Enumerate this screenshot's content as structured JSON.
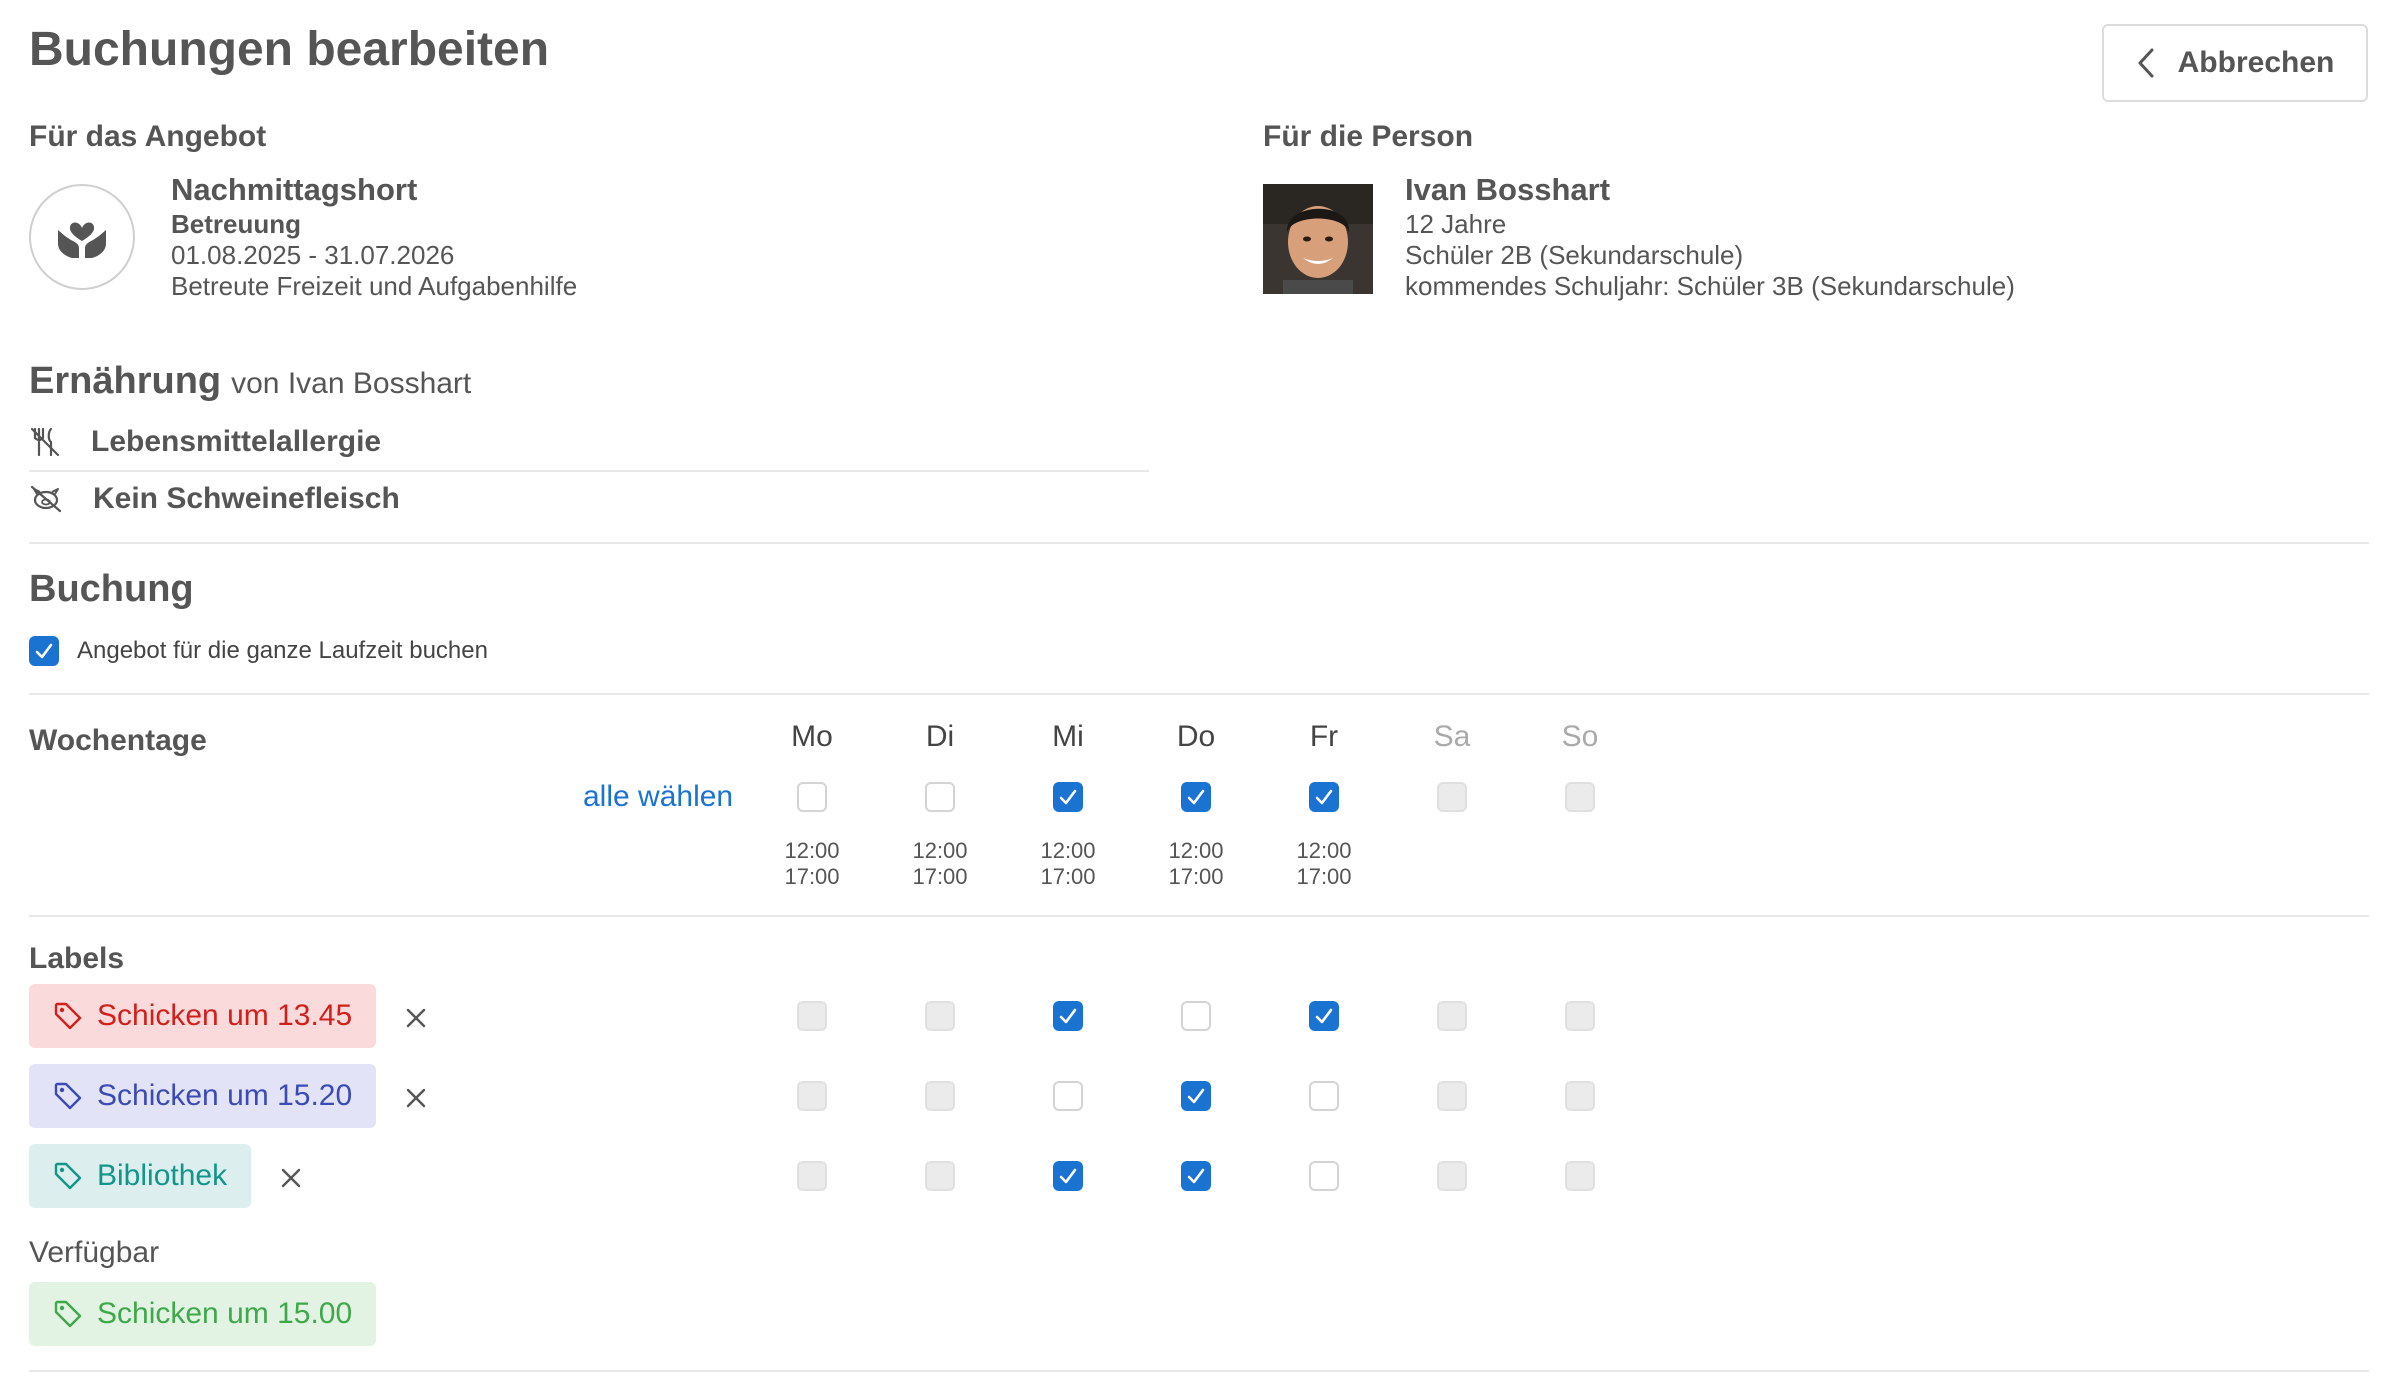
{
  "header": {
    "title": "Buchungen bearbeiten",
    "cancel_label": "Abbrechen"
  },
  "offer": {
    "section_label": "Für das Angebot",
    "name": "Nachmittagshort",
    "category": "Betreuung",
    "period": "01.08.2025 - 31.07.2026",
    "description": "Betreute Freizeit und Aufgabenhilfe"
  },
  "person": {
    "section_label": "Für die Person",
    "name": "Ivan Bosshart",
    "age": "12 Jahre",
    "class": "Schüler 2B (Sekundarschule)",
    "next_year": "kommendes Schuljahr: Schüler 3B (Sekundarschule)"
  },
  "nutrition": {
    "heading": "Ernährung",
    "subheading": "von Ivan Bosshart",
    "items": [
      {
        "icon": "no-food-icon",
        "label": "Lebensmittelallergie"
      },
      {
        "icon": "no-pork-icon",
        "label": "Kein Schweinefleisch"
      }
    ]
  },
  "booking": {
    "heading": "Buchung",
    "whole_period_label": "Angebot für die ganze Laufzeit buchen",
    "whole_period_checked": true,
    "weekdays_label": "Wochentage",
    "select_all_label": "alle wählen",
    "days": [
      {
        "label": "Mo",
        "state": "off",
        "start": "12:00",
        "end": "17:00"
      },
      {
        "label": "Di",
        "state": "off",
        "start": "12:00",
        "end": "17:00"
      },
      {
        "label": "Mi",
        "state": "on",
        "start": "12:00",
        "end": "17:00"
      },
      {
        "label": "Do",
        "state": "on",
        "start": "12:00",
        "end": "17:00"
      },
      {
        "label": "Fr",
        "state": "on",
        "start": "12:00",
        "end": "17:00"
      },
      {
        "label": "Sa",
        "state": "dis",
        "start": "",
        "end": ""
      },
      {
        "label": "So",
        "state": "dis",
        "start": "",
        "end": ""
      }
    ]
  },
  "labels": {
    "heading": "Labels",
    "items": [
      {
        "label": "Schicken um 13.45",
        "bg": "#fadadb",
        "fg": "#d0201c",
        "states": [
          "dis",
          "dis",
          "on",
          "off",
          "on",
          "dis",
          "dis"
        ]
      },
      {
        "label": "Schicken um 15.20",
        "bg": "#e2e3f6",
        "fg": "#3b4bb3",
        "states": [
          "dis",
          "dis",
          "off",
          "on",
          "off",
          "dis",
          "dis"
        ]
      },
      {
        "label": "Bibliothek",
        "bg": "#dcefee",
        "fg": "#12968a",
        "states": [
          "dis",
          "dis",
          "on",
          "on",
          "off",
          "dis",
          "dis"
        ]
      }
    ],
    "available_heading": "Verfügbar",
    "available": [
      {
        "label": "Schicken um 15.00",
        "bg": "#e2f3e3",
        "fg": "#3ea84a"
      }
    ]
  },
  "colors": {
    "accent": "#1a73d1",
    "text": "#555555",
    "divider": "#e8e8e8"
  }
}
